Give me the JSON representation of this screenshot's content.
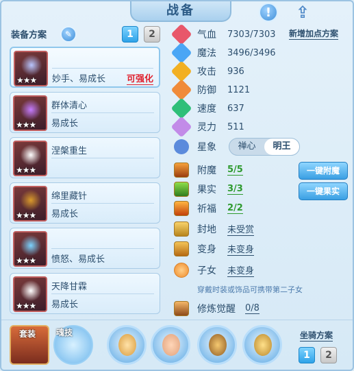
{
  "header": {
    "title": "战备"
  },
  "left": {
    "title": "装备方案",
    "plans": [
      "1",
      "2"
    ],
    "cards": [
      {
        "name": "妙手、易成长",
        "sub": "",
        "tag": "可强化",
        "stars": "★★★",
        "glow": "#b9c6ff"
      },
      {
        "name": "群体清心",
        "sub": "易成长",
        "tag": "",
        "stars": "★★★",
        "glow": "#c47cff"
      },
      {
        "name": "涅槃重生",
        "sub": "",
        "tag": "",
        "stars": "★★★",
        "glow": "#ffffff"
      },
      {
        "name": "绵里藏针",
        "sub": "易成长",
        "tag": "",
        "stars": "★★★",
        "glow": "#d99a2b"
      },
      {
        "name": "",
        "sub": "愤怒、易成长",
        "tag": "",
        "stars": "★★★",
        "glow": "#7bd4ff"
      },
      {
        "name": "天降甘霖",
        "sub": "易成长",
        "tag": "",
        "stars": "★★★",
        "glow": "#ffffff"
      }
    ]
  },
  "stats": {
    "plan_button": "新增加点方案",
    "rows": [
      {
        "label": "气血",
        "value": "7303/7303",
        "color": "#e8576a"
      },
      {
        "label": "魔法",
        "value": "3496/3496",
        "color": "#4aa6f5"
      },
      {
        "label": "攻击",
        "value": "936",
        "color": "#f2b022"
      },
      {
        "label": "防御",
        "value": "1121",
        "color": "#f08b3a"
      },
      {
        "label": "速度",
        "value": "637",
        "color": "#2fbf79"
      },
      {
        "label": "灵力",
        "value": "511",
        "color": "#c28be8"
      }
    ],
    "star_label": "星象",
    "star_options": [
      "禅心",
      "明王"
    ]
  },
  "extras": {
    "rows": [
      {
        "label": "附魔",
        "value": "5/5"
      },
      {
        "label": "果实",
        "value": "3/3"
      },
      {
        "label": "祈福",
        "value": "2/2"
      },
      {
        "label": "封地",
        "value": "未受赏"
      },
      {
        "label": "变身",
        "value": "未变身"
      },
      {
        "label": "子女",
        "value": "未变身"
      }
    ],
    "btn_enchant": "一键附魔",
    "btn_fruit": "一键果实",
    "hint": "穿戴时装或饰品可携带第二子女",
    "awaken_label": "修炼觉醒",
    "awaken_value": "0/8"
  },
  "bottom": {
    "suit_label": "套装",
    "soul_label": "魂技",
    "mount_title": "坐骑方案",
    "mount_plans": [
      "1",
      "2"
    ]
  }
}
